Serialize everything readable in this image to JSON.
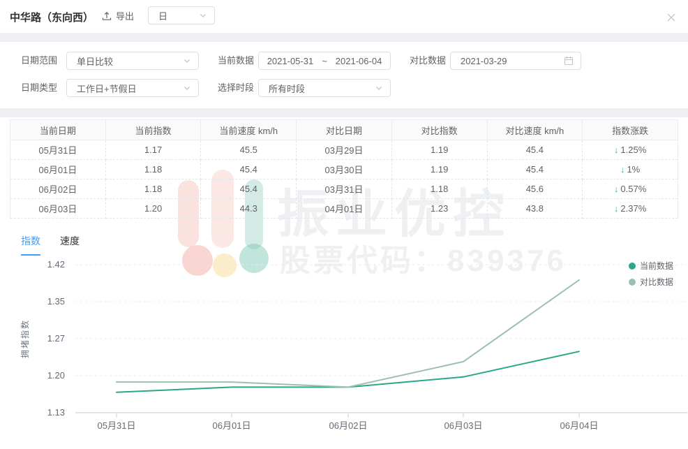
{
  "header": {
    "title": "中华路（东向西）",
    "export_label": "导出",
    "period_value": "日"
  },
  "filters": {
    "date_range": {
      "label": "日期范围",
      "value": "单日比较"
    },
    "current_data": {
      "label": "当前数据",
      "start": "2021-05-31",
      "separator": "~",
      "end": "2021-06-04"
    },
    "compare_data": {
      "label": "对比数据",
      "value": "2021-03-29"
    },
    "date_type": {
      "label": "日期类型",
      "value": "工作日+节假日"
    },
    "time_period": {
      "label": "选择时段",
      "value": "所有时段"
    }
  },
  "table": {
    "columns": [
      "当前日期",
      "当前指数",
      "当前速度 km/h",
      "对比日期",
      "对比指数",
      "对比速度 km/h",
      "指数涨跌"
    ],
    "rows": [
      {
        "cells": [
          "05月31日",
          "1.17",
          "45.5",
          "03月29日",
          "1.19",
          "45.4"
        ],
        "change": {
          "direction": "down",
          "value": "1.25%"
        }
      },
      {
        "cells": [
          "06月01日",
          "1.18",
          "45.4",
          "03月30日",
          "1.19",
          "45.4"
        ],
        "change": {
          "direction": "down",
          "value": "1%"
        }
      },
      {
        "cells": [
          "06月02日",
          "1.18",
          "45.4",
          "03月31日",
          "1.18",
          "45.6"
        ],
        "change": {
          "direction": "down",
          "value": "0.57%"
        }
      },
      {
        "cells": [
          "06月03日",
          "1.20",
          "44.3",
          "04月01日",
          "1.23",
          "43.8"
        ],
        "change": {
          "direction": "down",
          "value": "2.37%"
        }
      }
    ]
  },
  "tabs": [
    {
      "label": "指数",
      "active": true
    },
    {
      "label": "速度",
      "active": false
    }
  ],
  "watermark": {
    "brand": "振业优控",
    "stock": "股票代码：839376"
  },
  "chart_data": {
    "type": "line",
    "categories": [
      "05月31日",
      "06月01日",
      "06月02日",
      "06月03日",
      "06月04日"
    ],
    "series": [
      {
        "name": "当前数据",
        "color": "#2aa78a",
        "values": [
          1.17,
          1.18,
          1.18,
          1.2,
          1.25
        ]
      },
      {
        "name": "对比数据",
        "color": "#9cbfb1",
        "values": [
          1.19,
          1.19,
          1.18,
          1.23,
          1.39
        ]
      }
    ],
    "ylabel": "拥堵指数",
    "yticks": [
      "1.13",
      "1.20",
      "1.27",
      "1.35",
      "1.42"
    ],
    "ylim": [
      1.13,
      1.42
    ],
    "grid": "dashed-horizontal",
    "legend_position": "top-right"
  },
  "colors": {
    "accent_blue": "#409eff",
    "down_teal": "#2cb9a3",
    "axis_text": "#646b73"
  }
}
